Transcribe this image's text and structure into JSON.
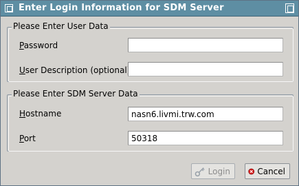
{
  "window": {
    "title": "Enter Login Information for SDM Server"
  },
  "user_panel": {
    "legend": "Please Enter User Data",
    "password": {
      "label_mnemonic": "P",
      "label_rest": "assword",
      "value": ""
    },
    "description": {
      "label_mnemonic": "U",
      "label_rest": "ser Description (optional)",
      "value": ""
    }
  },
  "server_panel": {
    "legend": "Please Enter SDM Server Data",
    "hostname": {
      "label_mnemonic": "H",
      "label_rest": "ostname",
      "value": "nasn6.livmi.trw.com"
    },
    "port": {
      "label_mnemonic": "P",
      "label_rest": "ort",
      "value": "50318"
    }
  },
  "buttons": {
    "login": "Login",
    "cancel": "Cancel"
  },
  "icons": {
    "login": "key-icon",
    "cancel": "cancel-icon"
  },
  "colors": {
    "titlebar": "#5e8ea3",
    "background": "#d4d2ce",
    "cancel_icon": "#d91c1c"
  }
}
